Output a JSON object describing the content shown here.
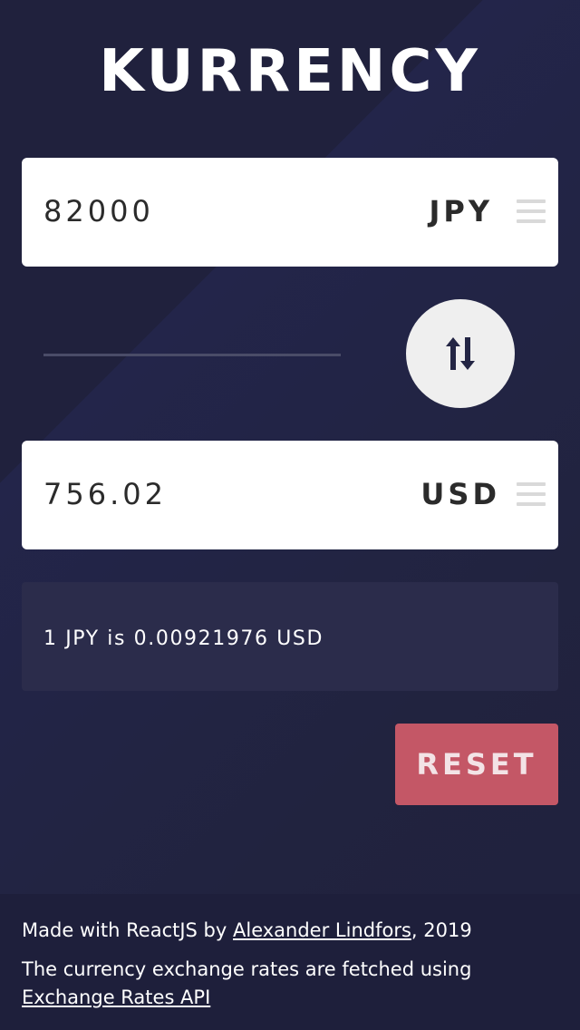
{
  "app": {
    "title": "KURRENCY"
  },
  "from": {
    "amount": "82000",
    "currency": "JPY"
  },
  "to": {
    "amount": "756.02",
    "currency": "USD"
  },
  "rate": {
    "text": "1 JPY is 0.00921976 USD"
  },
  "actions": {
    "reset_label": "RESET"
  },
  "footer": {
    "made_prefix": "Made with ReactJS by ",
    "author_link": "Alexander Lindfors",
    "made_suffix": ", 2019",
    "rates_text": "The currency exchange rates are fetched using",
    "api_link": "Exchange Rates API"
  },
  "icons": {
    "swap": "swap-vertical-icon",
    "menu": "hamburger-menu-icon"
  },
  "colors": {
    "background": "#21223f",
    "card": "#ffffff",
    "rate_box": "#2b2c4b",
    "reset_button": "#c45766",
    "footer": "#1e1f3b"
  }
}
